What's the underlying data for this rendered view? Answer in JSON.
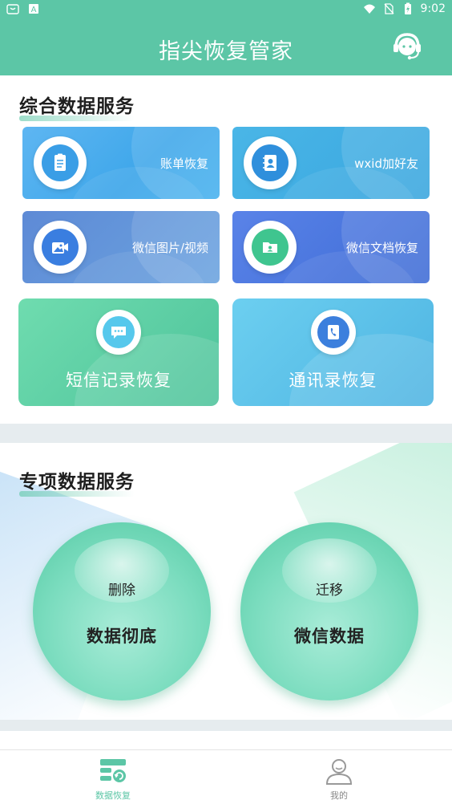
{
  "status_bar": {
    "time": "9:02"
  },
  "app": {
    "title": "指尖恢复管家"
  },
  "section_general": {
    "title": "综合数据服务",
    "cards": [
      {
        "label": "账单恢复",
        "icon": "bill-icon"
      },
      {
        "label": "wxid加好友",
        "icon": "contact-book-icon"
      },
      {
        "label": "微信图片/视频",
        "icon": "image-video-icon"
      },
      {
        "label": "微信文档恢复",
        "icon": "folder-icon"
      }
    ],
    "big_cards": [
      {
        "label": "短信记录恢复",
        "icon": "sms-icon"
      },
      {
        "label": "通讯录恢复",
        "icon": "phone-contacts-icon"
      }
    ]
  },
  "section_special": {
    "title": "专项数据服务",
    "orbs": [
      {
        "small": "删除",
        "big": "数据彻底"
      },
      {
        "small": "迁移",
        "big": "微信数据"
      }
    ]
  },
  "tabbar": {
    "tabs": [
      {
        "label": "数据恢复",
        "active": true
      },
      {
        "label": "我的",
        "active": false
      }
    ],
    "active_color": "#5cc6a6",
    "inactive_color": "#888888"
  },
  "colors": {
    "brand": "#5cc6a6"
  }
}
